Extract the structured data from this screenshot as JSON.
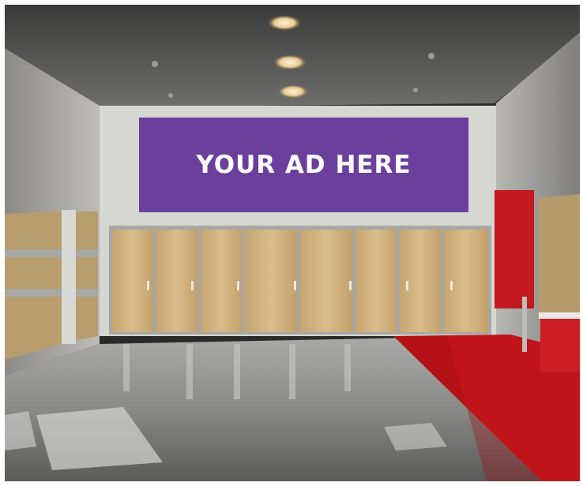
{
  "ad": {
    "text": "YOUR AD HERE",
    "background": "#6b3f9c",
    "text_color": "#ffffff"
  },
  "scene": {
    "carpet_color": "#c0141a",
    "floor_color": "#8f8f8f",
    "wall_color": "#d8d8d6",
    "door_color": "#c9a873"
  }
}
